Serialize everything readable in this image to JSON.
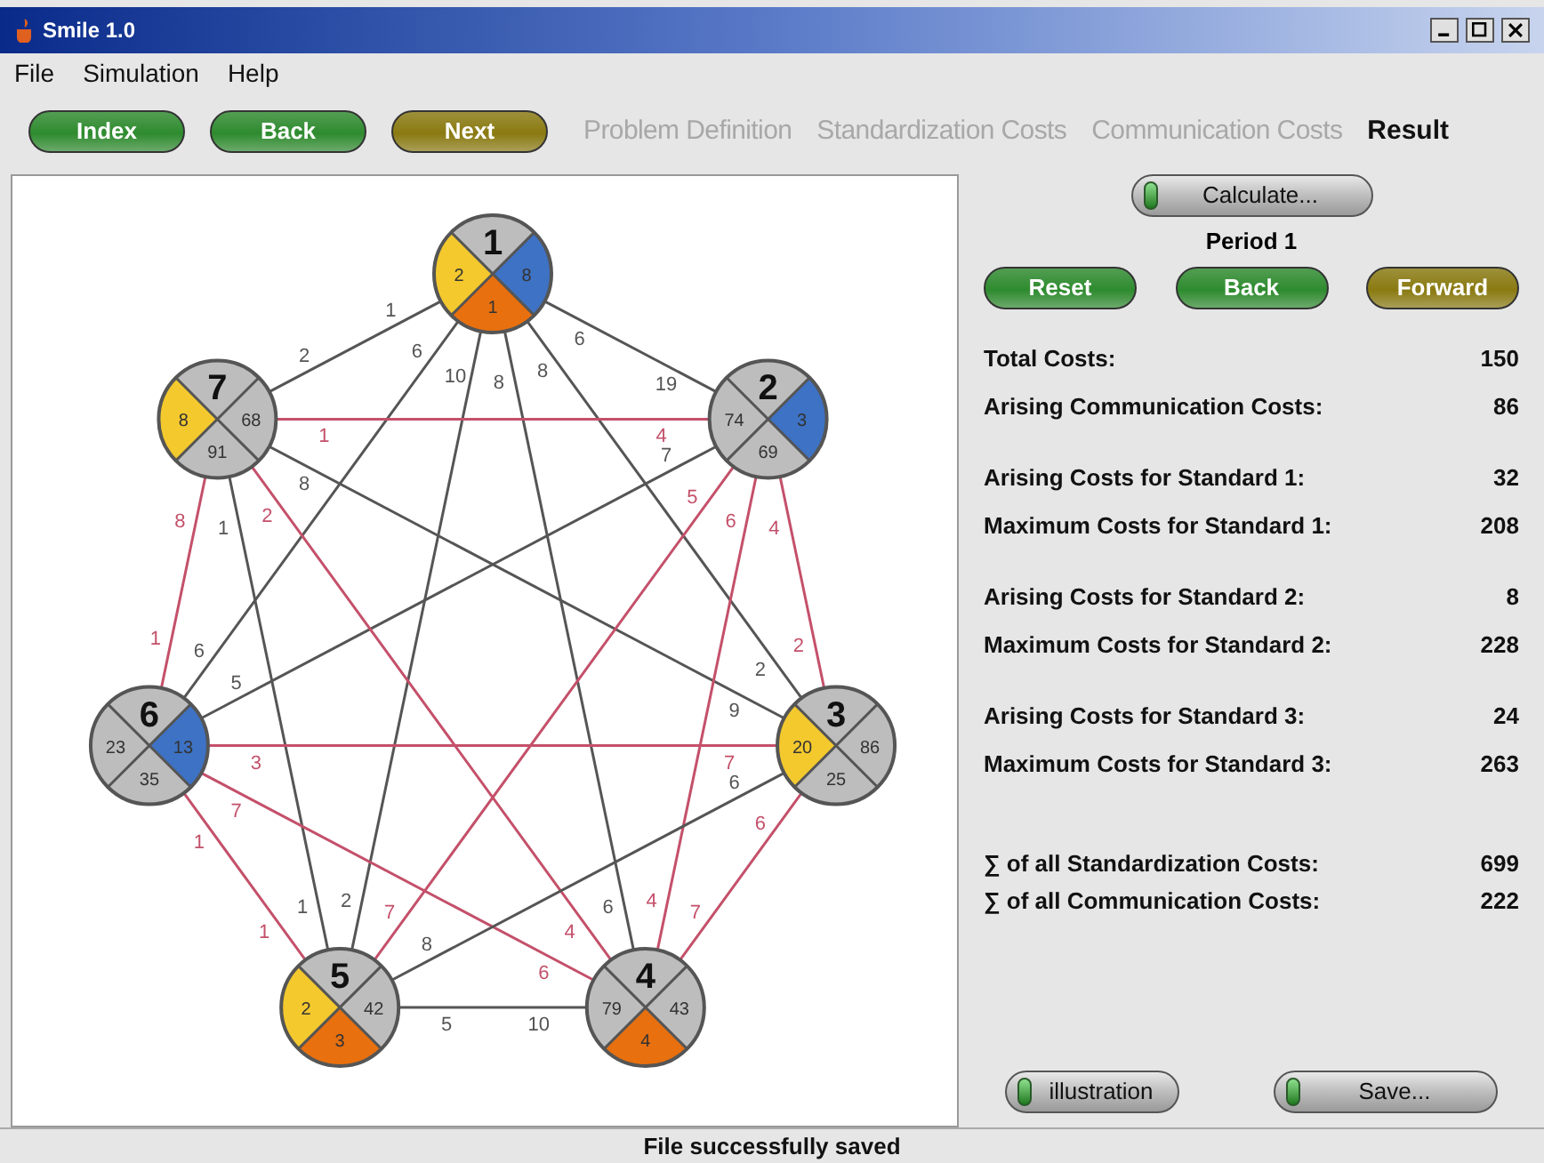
{
  "window": {
    "title": "Smile 1.0"
  },
  "menu": [
    "File",
    "Simulation",
    "Help"
  ],
  "nav_buttons": [
    {
      "label": "Index",
      "color": "#2e8b2e"
    },
    {
      "label": "Back",
      "color": "#2e8b2e"
    },
    {
      "label": "Next",
      "color": "#8a7a10"
    }
  ],
  "steps": [
    {
      "label": "Problem Definition",
      "selected": false
    },
    {
      "label": "Standardization Costs",
      "selected": false
    },
    {
      "label": "Communication Costs",
      "selected": false
    },
    {
      "label": "Result",
      "selected": true
    }
  ],
  "graph": {
    "nodes": [
      {
        "id": "1",
        "left": {
          "value": "2",
          "color": "#f4c92e"
        },
        "right": {
          "value": "8",
          "color": "#3d72c4"
        },
        "bottom": {
          "value": "1",
          "color": "#e8700f"
        }
      },
      {
        "id": "7",
        "left": {
          "value": "8",
          "color": "#f4c92e"
        },
        "right": {
          "value": "68",
          "color": "#bdbdbd"
        },
        "bottom": {
          "value": "91",
          "color": "#bdbdbd"
        }
      },
      {
        "id": "2",
        "left": {
          "value": "74",
          "color": "#bdbdbd"
        },
        "right": {
          "value": "3",
          "color": "#3d72c4"
        },
        "bottom": {
          "value": "69",
          "color": "#bdbdbd"
        }
      },
      {
        "id": "6",
        "left": {
          "value": "23",
          "color": "#bdbdbd"
        },
        "right": {
          "value": "13",
          "color": "#3d72c4"
        },
        "bottom": {
          "value": "35",
          "color": "#bdbdbd"
        }
      },
      {
        "id": "3",
        "left": {
          "value": "20",
          "color": "#f4c92e"
        },
        "right": {
          "value": "86",
          "color": "#bdbdbd"
        },
        "bottom": {
          "value": "25",
          "color": "#bdbdbd"
        }
      },
      {
        "id": "5",
        "left": {
          "value": "2",
          "color": "#f4c92e"
        },
        "right": {
          "value": "42",
          "color": "#bdbdbd"
        },
        "bottom": {
          "value": "3",
          "color": "#e8700f"
        }
      },
      {
        "id": "4",
        "left": {
          "value": "79",
          "color": "#bdbdbd"
        },
        "right": {
          "value": "43",
          "color": "#bdbdbd"
        },
        "bottom": {
          "value": "4",
          "color": "#e8700f"
        }
      }
    ],
    "edges": [
      {
        "labels": [
          "6",
          "6"
        ],
        "color": "#555555"
      },
      {
        "labels": [
          "1",
          "2"
        ],
        "color": "#555555"
      },
      {
        "labels": [
          "10",
          "2"
        ],
        "color": "#555555"
      },
      {
        "labels": [
          "8",
          "6"
        ],
        "color": "#555555"
      },
      {
        "labels": [
          "8",
          "2"
        ],
        "color": "#555555"
      },
      {
        "labels": [
          "6",
          "19"
        ],
        "color": "#555555"
      },
      {
        "labels": [
          "8",
          "1"
        ],
        "color": "#c4506a"
      },
      {
        "labels": [
          "7",
          "5"
        ],
        "color": "#555555"
      },
      {
        "labels": [
          "1",
          "1"
        ],
        "color": "#555555"
      },
      {
        "labels": [
          "2",
          "4"
        ],
        "color": "#c4506a"
      },
      {
        "labels": [
          "1",
          "4"
        ],
        "color": "#c4506a"
      },
      {
        "labels": [
          "8",
          "9"
        ],
        "color": "#555555"
      },
      {
        "labels": [
          "5",
          "7"
        ],
        "color": "#c4506a"
      },
      {
        "labels": [
          "6",
          "4"
        ],
        "color": "#c4506a"
      },
      {
        "labels": [
          "4",
          "2"
        ],
        "color": "#c4506a"
      },
      {
        "labels": [
          "3",
          "7"
        ],
        "color": "#c4506a"
      },
      {
        "labels": [
          "1",
          "1"
        ],
        "color": "#c4506a"
      },
      {
        "labels": [
          "7",
          "6"
        ],
        "color": "#c4506a"
      },
      {
        "labels": [
          "6",
          "8"
        ],
        "color": "#555555"
      },
      {
        "labels": [
          "6",
          "7"
        ],
        "color": "#c4506a"
      },
      {
        "labels": [
          "5",
          "10"
        ],
        "color": "#555555"
      }
    ]
  },
  "results": {
    "calculate_button": "Calculate...",
    "period": "Period 1",
    "period_buttons": [
      {
        "label": "Reset",
        "color": "#2e8b2e"
      },
      {
        "label": "Back",
        "color": "#2e8b2e"
      },
      {
        "label": "Forward",
        "color": "#8a7a10"
      }
    ],
    "groups": [
      [
        {
          "label": "Total Costs:",
          "value": "150"
        },
        {
          "label": "Arising Communication Costs:",
          "value": "86"
        }
      ],
      [
        {
          "label": "Arising Costs for Standard 1:",
          "value": "32"
        },
        {
          "label": "Maximum Costs for Standard 1:",
          "value": "208"
        }
      ],
      [
        {
          "label": "Arising Costs for Standard 2:",
          "value": "8"
        },
        {
          "label": "Maximum Costs for Standard 2:",
          "value": "228"
        }
      ],
      [
        {
          "label": "Arising Costs for Standard 3:",
          "value": "24"
        },
        {
          "label": "Maximum Costs for Standard 3:",
          "value": "263"
        }
      ],
      [
        {
          "label": "∑ of all Standardization Costs:",
          "value": "699"
        },
        {
          "label": "∑ of all Communication Costs:",
          "value": "222"
        }
      ]
    ],
    "bottom_buttons": [
      "illustration",
      "Save..."
    ]
  },
  "status_bar": "File successfully saved"
}
